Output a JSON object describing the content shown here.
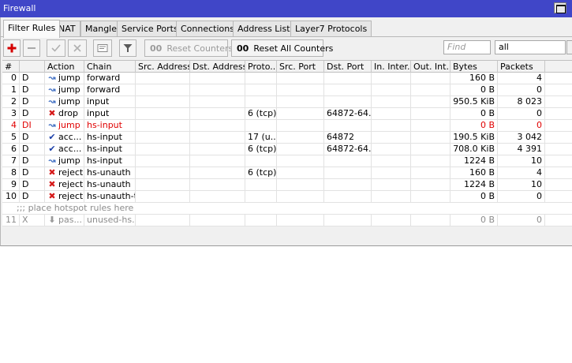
{
  "window": {
    "title": "Firewall"
  },
  "tabs": [
    {
      "label": "Filter Rules",
      "active": true
    },
    {
      "label": "NAT"
    },
    {
      "label": "Mangle"
    },
    {
      "label": "Service Ports"
    },
    {
      "label": "Connections"
    },
    {
      "label": "Address Lists"
    },
    {
      "label": "Layer7 Protocols"
    }
  ],
  "toolbar": {
    "add_icon": "plus-icon",
    "remove_icon": "minus-icon",
    "enable_icon": "check-icon",
    "disable_icon": "x-icon",
    "comment_icon": "comment-icon",
    "filter_icon": "filter-icon",
    "reset_counters_label": "Reset Counters",
    "reset_all_label": "Reset All Counters",
    "reset_glyph": "00",
    "find_placeholder": "Find",
    "filter_value": "all"
  },
  "columns": [
    "#",
    "",
    "Action",
    "Chain",
    "Src. Address",
    "Dst. Address",
    "Proto...",
    "Src. Port",
    "Dst. Port",
    "In. Inter...",
    "Out. Int...",
    "Bytes",
    "Packets"
  ],
  "rows": [
    {
      "num": "0",
      "flag": "D",
      "action": "jump",
      "action_icon": "jump",
      "chain": "forward",
      "proto": "",
      "dst_port": "",
      "bytes": "160 B",
      "packets": "4",
      "style": ""
    },
    {
      "num": "1",
      "flag": "D",
      "action": "jump",
      "action_icon": "jump",
      "chain": "forward",
      "proto": "",
      "dst_port": "",
      "bytes": "0 B",
      "packets": "0",
      "style": ""
    },
    {
      "num": "2",
      "flag": "D",
      "action": "jump",
      "action_icon": "jump",
      "chain": "input",
      "proto": "",
      "dst_port": "",
      "bytes": "950.5 KiB",
      "packets": "8 023",
      "style": ""
    },
    {
      "num": "3",
      "flag": "D",
      "action": "drop",
      "action_icon": "drop",
      "chain": "input",
      "proto": "6 (tcp)",
      "dst_port": "64872-64...",
      "bytes": "0 B",
      "packets": "0",
      "style": ""
    },
    {
      "num": "4",
      "flag": "DI",
      "action": "jump",
      "action_icon": "jump",
      "chain": "hs-input",
      "proto": "",
      "dst_port": "",
      "bytes": "0 B",
      "packets": "0",
      "style": "red"
    },
    {
      "num": "5",
      "flag": "D",
      "action": "acc...",
      "action_icon": "accept",
      "chain": "hs-input",
      "proto": "17 (u...",
      "dst_port": "64872",
      "bytes": "190.5 KiB",
      "packets": "3 042",
      "style": ""
    },
    {
      "num": "6",
      "flag": "D",
      "action": "acc...",
      "action_icon": "accept",
      "chain": "hs-input",
      "proto": "6 (tcp)",
      "dst_port": "64872-64...",
      "bytes": "708.0 KiB",
      "packets": "4 391",
      "style": ""
    },
    {
      "num": "7",
      "flag": "D",
      "action": "jump",
      "action_icon": "jump",
      "chain": "hs-input",
      "proto": "",
      "dst_port": "",
      "bytes": "1224 B",
      "packets": "10",
      "style": ""
    },
    {
      "num": "8",
      "flag": "D",
      "action": "reject",
      "action_icon": "drop",
      "chain": "hs-unauth",
      "proto": "6 (tcp)",
      "dst_port": "",
      "bytes": "160 B",
      "packets": "4",
      "style": ""
    },
    {
      "num": "9",
      "flag": "D",
      "action": "reject",
      "action_icon": "drop",
      "chain": "hs-unauth",
      "proto": "",
      "dst_port": "",
      "bytes": "1224 B",
      "packets": "10",
      "style": ""
    },
    {
      "num": "10",
      "flag": "D",
      "action": "reject",
      "action_icon": "drop",
      "chain": "hs-unauth-to",
      "proto": "",
      "dst_port": "",
      "bytes": "0 B",
      "packets": "0",
      "style": ""
    }
  ],
  "comment": ";;; place hotspot rules here",
  "disabled_row": {
    "num": "11",
    "flag": "X",
    "action": "pas...",
    "action_icon": "pass",
    "chain": "unused-hs...",
    "bytes": "0 B",
    "packets": "0"
  },
  "colors": {
    "title_bar": "#4046c8",
    "disabled_red": "#e00000",
    "jump_icon": "#3f6ec2",
    "drop_icon": "#d61a1a"
  }
}
